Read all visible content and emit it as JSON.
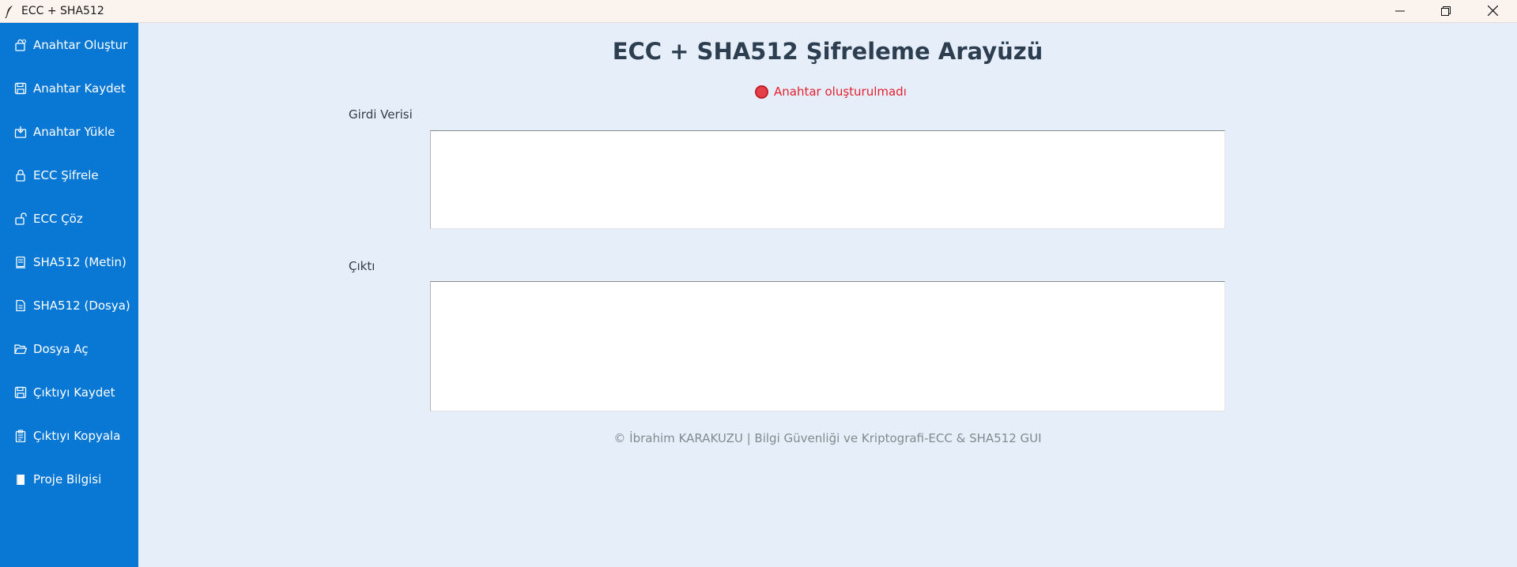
{
  "window": {
    "title": "ECC + SHA512",
    "controls": [
      "minimize-icon",
      "restore-icon",
      "close-icon"
    ]
  },
  "sidebar": {
    "background": "#0978d4",
    "items": [
      {
        "label": "Anahtar Oluştur",
        "icon": "key-gen-icon"
      },
      {
        "label": "Anahtar Kaydet",
        "icon": "save-icon"
      },
      {
        "label": "Anahtar Yükle",
        "icon": "load-icon"
      },
      {
        "label": "ECC Şifrele",
        "icon": "lock-icon"
      },
      {
        "label": "ECC Çöz",
        "icon": "unlock-icon"
      },
      {
        "label": "SHA512 (Metin)",
        "icon": "text-doc-icon"
      },
      {
        "label": "SHA512 (Dosya)",
        "icon": "file-icon"
      },
      {
        "label": "Dosya Aç",
        "icon": "folder-open-icon"
      },
      {
        "label": "Çıktıyı Kaydet",
        "icon": "save-icon"
      },
      {
        "label": "Çıktıyı Kopyala",
        "icon": "clipboard-icon"
      },
      {
        "label": "Proje Bilgisi",
        "icon": "book-icon"
      }
    ]
  },
  "main": {
    "title": "ECC + SHA512 Şifreleme Arayüzü",
    "status": {
      "text": "Anahtar oluşturulmadı",
      "color": "#e5202e"
    },
    "input_label": "Girdi Verisi",
    "input_value": "",
    "output_label": "Çıktı",
    "output_value": "",
    "footer": "© İbrahim KARAKUZU | Bilgi Güvenliği ve Kriptografi-ECC & SHA512 GUI"
  }
}
